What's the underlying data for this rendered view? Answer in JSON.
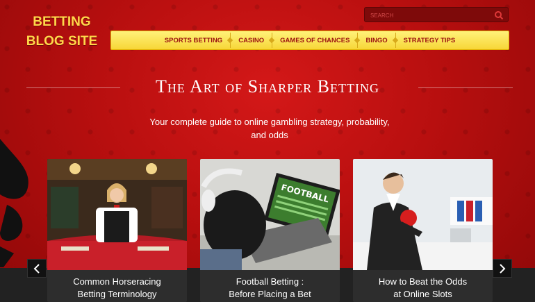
{
  "site": {
    "logo_line1": "BETTING",
    "logo_line2": "BLOG SITE"
  },
  "search": {
    "placeholder": "SEARCH"
  },
  "nav": {
    "items": [
      "SPORTS BETTING",
      "CASINO",
      "GAMES OF CHANCES",
      "BINGO",
      "STRATEGY TIPS"
    ]
  },
  "hero": {
    "title": "The Art of Sharper Betting",
    "subtitle_line1": "Your complete guide to online gambling strategy, probability,",
    "subtitle_line2": "and odds"
  },
  "cards": [
    {
      "line1": "Common Horseracing",
      "line2": "Betting Terminology"
    },
    {
      "line1": "Football Betting :",
      "line2": "Before Placing a Bet"
    },
    {
      "line1": "How to Beat the Odds",
      "line2": "at Online Slots"
    }
  ],
  "colors": {
    "accent_red": "#b80f0f",
    "nav_yellow": "#f7d637",
    "logo_yellow": "#ffd84a"
  }
}
